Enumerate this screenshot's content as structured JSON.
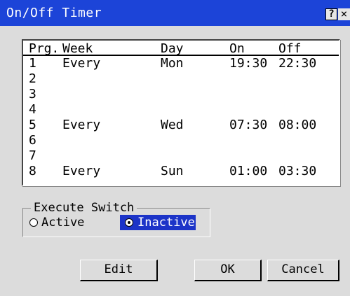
{
  "title": "On/Off Timer",
  "titlebar": {
    "help": "?",
    "close": "×"
  },
  "columns": {
    "prg": "Prg.",
    "week": "Week",
    "day": "Day",
    "on": "On",
    "off": "Off"
  },
  "rows": [
    {
      "prg": "1",
      "week": "Every",
      "day": "Mon",
      "on": "19:30",
      "off": "22:30"
    },
    {
      "prg": "2",
      "week": "",
      "day": "",
      "on": "",
      "off": ""
    },
    {
      "prg": "3",
      "week": "",
      "day": "",
      "on": "",
      "off": ""
    },
    {
      "prg": "4",
      "week": "",
      "day": "",
      "on": "",
      "off": ""
    },
    {
      "prg": "5",
      "week": "Every",
      "day": "Wed",
      "on": "07:30",
      "off": "08:00"
    },
    {
      "prg": "6",
      "week": "",
      "day": "",
      "on": "",
      "off": ""
    },
    {
      "prg": "7",
      "week": "",
      "day": "",
      "on": "",
      "off": ""
    },
    {
      "prg": "8",
      "week": "Every",
      "day": "Sun",
      "on": "01:00",
      "off": "03:30"
    }
  ],
  "execute_switch": {
    "label": "Execute Switch",
    "active": "Active",
    "inactive": "Inactive",
    "selected": "Inactive"
  },
  "buttons": {
    "edit": "Edit",
    "ok": "OK",
    "cancel": "Cancel"
  },
  "colors": {
    "title_bar": "#1c44d8",
    "selection": "#1c34c8",
    "window_bg": "#dcdcdc"
  }
}
